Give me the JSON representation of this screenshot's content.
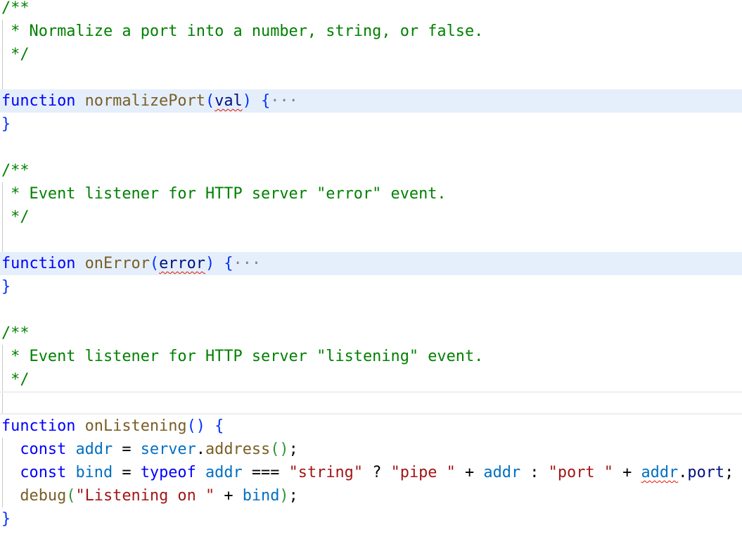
{
  "editor": {
    "lines": [
      {
        "tokens": [
          [
            "/**",
            "cm"
          ]
        ]
      },
      {
        "guide": true,
        "tokens": [
          [
            " * Normalize a port into a number, string, or false.",
            "cm"
          ]
        ]
      },
      {
        "guide": true,
        "tokens": [
          [
            " */",
            "cm"
          ]
        ]
      },
      {
        "guide": true,
        "tokens": []
      },
      {
        "folded": true,
        "tokens": [
          [
            "function",
            "kw"
          ],
          [
            " ",
            "txt"
          ],
          [
            "normalizePort",
            "fn"
          ],
          [
            "(",
            "br"
          ],
          [
            "val",
            "param err"
          ],
          [
            ")",
            "br"
          ],
          [
            " ",
            "txt"
          ],
          [
            "{",
            "br"
          ],
          [
            "···",
            "ell"
          ]
        ]
      },
      {
        "tokens": [
          [
            "}",
            "br"
          ]
        ]
      },
      {
        "tokens": []
      },
      {
        "tokens": [
          [
            "/**",
            "cm"
          ]
        ]
      },
      {
        "guide": true,
        "tokens": [
          [
            " * Event listener for HTTP server \"error\" event.",
            "cm"
          ]
        ]
      },
      {
        "guide": true,
        "tokens": [
          [
            " */",
            "cm"
          ]
        ]
      },
      {
        "guide": true,
        "tokens": []
      },
      {
        "folded": true,
        "tokens": [
          [
            "function",
            "kw"
          ],
          [
            " ",
            "txt"
          ],
          [
            "onError",
            "fn"
          ],
          [
            "(",
            "br"
          ],
          [
            "error",
            "param err"
          ],
          [
            ")",
            "br"
          ],
          [
            " ",
            "txt"
          ],
          [
            "{",
            "br"
          ],
          [
            "···",
            "ell"
          ]
        ]
      },
      {
        "tokens": [
          [
            "}",
            "br"
          ]
        ]
      },
      {
        "tokens": []
      },
      {
        "tokens": [
          [
            "/**",
            "cm"
          ]
        ]
      },
      {
        "guide": true,
        "tokens": [
          [
            " * Event listener for HTTP server \"listening\" event.",
            "cm"
          ]
        ]
      },
      {
        "guide": true,
        "tokens": [
          [
            " */",
            "cm"
          ]
        ]
      },
      {
        "guide": true,
        "current": true,
        "tokens": []
      },
      {
        "tokens": [
          [
            "function",
            "kw"
          ],
          [
            " ",
            "txt"
          ],
          [
            "onListening",
            "fn"
          ],
          [
            "()",
            "br"
          ],
          [
            " ",
            "txt"
          ],
          [
            "{",
            "br"
          ]
        ]
      },
      {
        "guide": true,
        "tokens": [
          [
            "  ",
            "txt"
          ],
          [
            "const",
            "kw"
          ],
          [
            " ",
            "txt"
          ],
          [
            "addr",
            "var"
          ],
          [
            " = ",
            "txt"
          ],
          [
            "server",
            "var"
          ],
          [
            ".",
            "txt"
          ],
          [
            "address",
            "fn"
          ],
          [
            "()",
            "br2"
          ],
          [
            ";",
            "txt"
          ]
        ]
      },
      {
        "guide": true,
        "tokens": [
          [
            "  ",
            "txt"
          ],
          [
            "const",
            "kw"
          ],
          [
            " ",
            "txt"
          ],
          [
            "bind",
            "var"
          ],
          [
            " = ",
            "txt"
          ],
          [
            "typeof",
            "kw"
          ],
          [
            " ",
            "txt"
          ],
          [
            "addr",
            "var"
          ],
          [
            " === ",
            "txt"
          ],
          [
            "\"string\"",
            "str"
          ],
          [
            " ? ",
            "txt"
          ],
          [
            "\"pipe \"",
            "str"
          ],
          [
            " + ",
            "txt"
          ],
          [
            "addr",
            "var"
          ],
          [
            " : ",
            "txt"
          ],
          [
            "\"port \"",
            "str"
          ],
          [
            " + ",
            "txt"
          ],
          [
            "addr",
            "var err"
          ],
          [
            ".",
            "txt"
          ],
          [
            "port",
            "param"
          ],
          [
            ";",
            "txt"
          ]
        ]
      },
      {
        "guide": true,
        "tokens": [
          [
            "  ",
            "txt"
          ],
          [
            "debug",
            "fn"
          ],
          [
            "(",
            "br2"
          ],
          [
            "\"Listening on \"",
            "str"
          ],
          [
            " + ",
            "txt"
          ],
          [
            "bind",
            "var"
          ],
          [
            ")",
            "br2"
          ],
          [
            ";",
            "txt"
          ]
        ]
      },
      {
        "tokens": [
          [
            "}",
            "br"
          ]
        ]
      }
    ]
  }
}
